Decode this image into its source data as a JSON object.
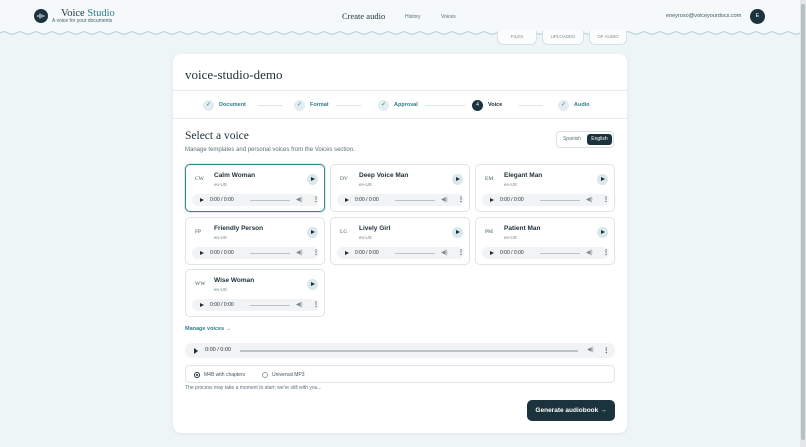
{
  "header": {
    "brand_primary": "Voice",
    "brand_secondary": "Studio",
    "tagline": "A voice for your documents",
    "nav_create": "Create audio",
    "nav_history": "History",
    "nav_voices": "Voices",
    "email": "eneyroso@voiceyourdocs.com",
    "avatar_initial": "E"
  },
  "pills": [
    "FILES",
    "UPLOADED",
    "OF AUDIO"
  ],
  "project_title": "voice-studio-demo",
  "steps": [
    {
      "label": "Document",
      "icon": "check",
      "state": "done"
    },
    {
      "label": "Format",
      "icon": "check",
      "state": "done"
    },
    {
      "label": "Approval",
      "icon": "check",
      "state": "done"
    },
    {
      "label": "Voice",
      "number": "4",
      "state": "active"
    },
    {
      "label": "Audio",
      "icon": "check",
      "state": "done"
    }
  ],
  "check_glyph": "✓",
  "section": {
    "title": "Select a voice",
    "subtitle": "Manage templates and personal voices from the Voices section."
  },
  "language": {
    "spanish": "Spanish",
    "english": "English",
    "selected": "English"
  },
  "voices": [
    {
      "initials": "CW",
      "name": "Calm Woman",
      "lang": "en-US",
      "time": "0:00 / 0:00",
      "selected": true
    },
    {
      "initials": "DV",
      "name": "Deep Voice Man",
      "lang": "en-US",
      "time": "0:00 / 0:00"
    },
    {
      "initials": "EM",
      "name": "Elegant Man",
      "lang": "en-US",
      "time": "0:00 / 0:00"
    },
    {
      "initials": "FP",
      "name": "Friendly Person",
      "lang": "en-US",
      "time": "0:00 / 0:00"
    },
    {
      "initials": "LG",
      "name": "Lively Girl",
      "lang": "en-US",
      "time": "0:00 / 0:00"
    },
    {
      "initials": "PM",
      "name": "Patient Man",
      "lang": "en-US",
      "time": "0:00 / 0:00"
    },
    {
      "initials": "WW",
      "name": "Wise Woman",
      "lang": "en-US",
      "time": "0:00 / 0:00"
    }
  ],
  "manage_voices": "Manage voices →",
  "preview_time": "0:00 / 0:00",
  "formats": {
    "m4b": "M4B with chapters",
    "mp3": "Universal MP3",
    "selected": "M4B with chapters"
  },
  "note": "The process may take a moment to start; we're still with you...",
  "generate_label": "Generate audiobook  →",
  "icons": {
    "volume": "volume-icon",
    "more": "more-vertical-icon",
    "play": "play-icon",
    "logo": "waveform-icon"
  },
  "colors": {
    "primary": "#1a333c",
    "accent": "#2d7f8f",
    "background": "#eef5f7"
  }
}
